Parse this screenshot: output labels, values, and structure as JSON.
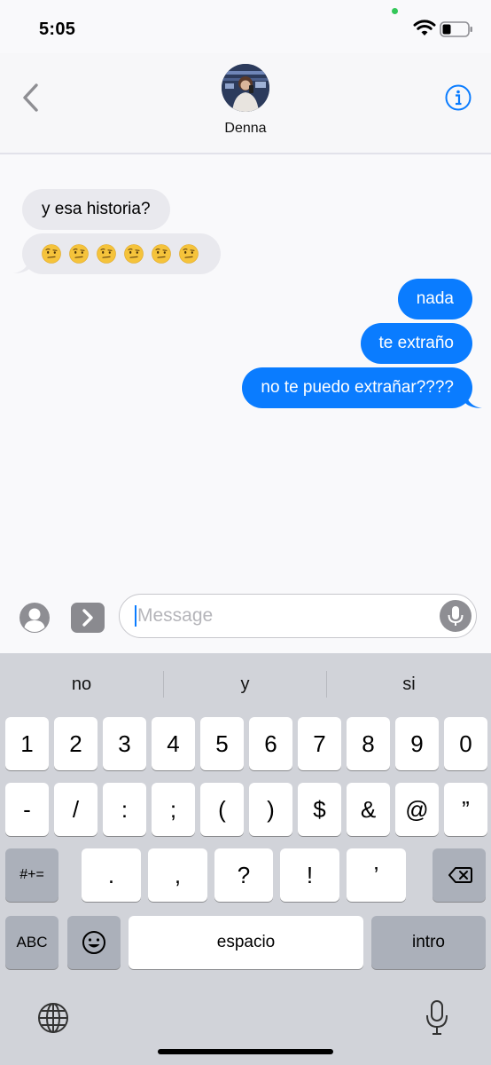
{
  "status_bar": {
    "time": "5:05"
  },
  "header": {
    "contact_name": "Denna"
  },
  "messages": [
    {
      "direction": "received",
      "text": "y esa historia?"
    },
    {
      "direction": "received",
      "text": "🤨🤨🤨🤨🤨🤨",
      "kind": "emoji",
      "emoji_count": 6
    },
    {
      "direction": "sent",
      "text": "nada"
    },
    {
      "direction": "sent",
      "text": "te extraño"
    },
    {
      "direction": "sent",
      "text": "no te puedo extrañar????"
    }
  ],
  "input": {
    "placeholder": "Message"
  },
  "keyboard": {
    "suggestions": [
      "no",
      "y",
      "si"
    ],
    "row1": [
      "1",
      "2",
      "3",
      "4",
      "5",
      "6",
      "7",
      "8",
      "9",
      "0"
    ],
    "row2": [
      "-",
      "/",
      ":",
      ";",
      "(",
      ")",
      "$",
      "&",
      "@",
      "”"
    ],
    "row3_left": "#+=",
    "row3": [
      ".",
      ",",
      "?",
      "!",
      "’"
    ],
    "row4_left": "ABC",
    "space": "espacio",
    "return": "intro"
  },
  "colors": {
    "accent": "#0a7cff",
    "received_bubble": "#e9e9ee",
    "keyboard_bg": "#d1d3d9"
  }
}
